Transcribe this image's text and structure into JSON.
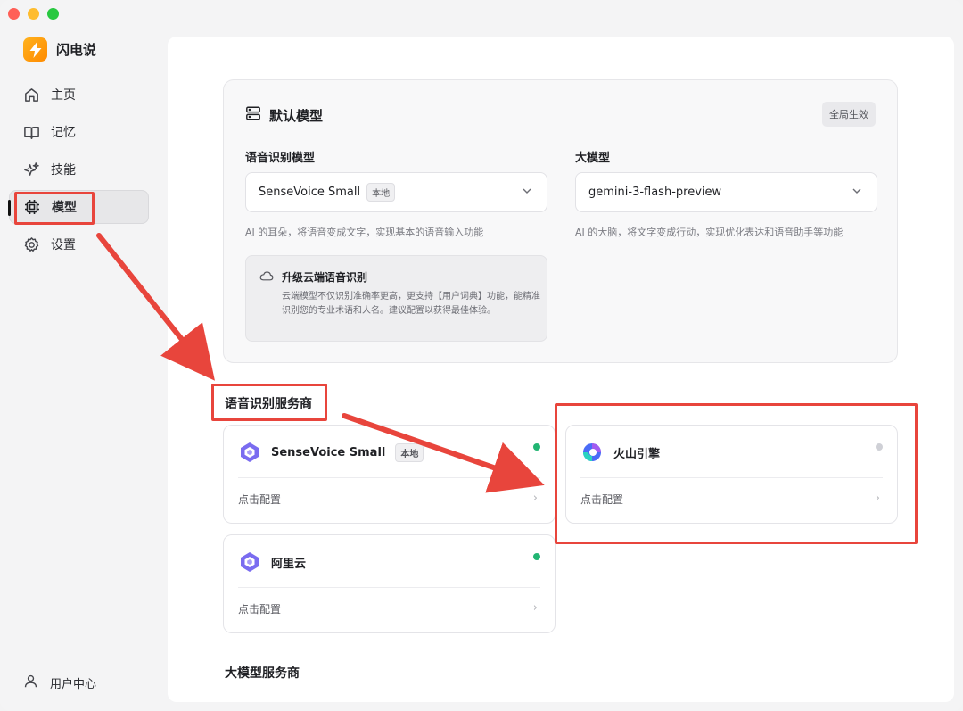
{
  "app": {
    "name": "闪电说"
  },
  "sidebar": {
    "items": [
      {
        "label": "主页",
        "icon": "home-icon"
      },
      {
        "label": "记忆",
        "icon": "book-icon"
      },
      {
        "label": "技能",
        "icon": "sparkles-icon"
      },
      {
        "label": "模型",
        "icon": "chip-icon",
        "active": true
      },
      {
        "label": "设置",
        "icon": "gear-icon"
      }
    ],
    "user_label": "用户中心"
  },
  "default_model": {
    "title": "默认模型",
    "badge": "全局生效",
    "asr": {
      "label": "语音识别模型",
      "value": "SenseVoice Small",
      "tag": "本地",
      "hint": "AI 的耳朵，将语音变成文字，实现基本的语音输入功能"
    },
    "llm": {
      "label": "大模型",
      "value": "gemini-3-flash-preview",
      "hint": "AI 的大脑，将文字变成行动，实现优化表达和语音助手等功能"
    },
    "upgrade": {
      "title": "升级云端语音识别",
      "desc": "云端模型不仅识别准确率更高，更支持【用户词典】功能，能精准识别您的专业术语和人名。建议配置以获得最佳体验。"
    }
  },
  "asr_providers": {
    "title": "语音识别服务商",
    "items": [
      {
        "name": "SenseVoice Small",
        "tag": "本地",
        "config": "点击配置",
        "status_color": "#22b573"
      },
      {
        "name": "火山引擎",
        "config": "点击配置",
        "status_color": "#cfd0d6"
      },
      {
        "name": "阿里云",
        "config": "点击配置",
        "status_color": "#22b573"
      }
    ]
  },
  "llm_providers": {
    "title": "大模型服务商"
  },
  "colors": {
    "accent": "#e8453c",
    "brand": "#ff9f0a",
    "online": "#22b573"
  }
}
